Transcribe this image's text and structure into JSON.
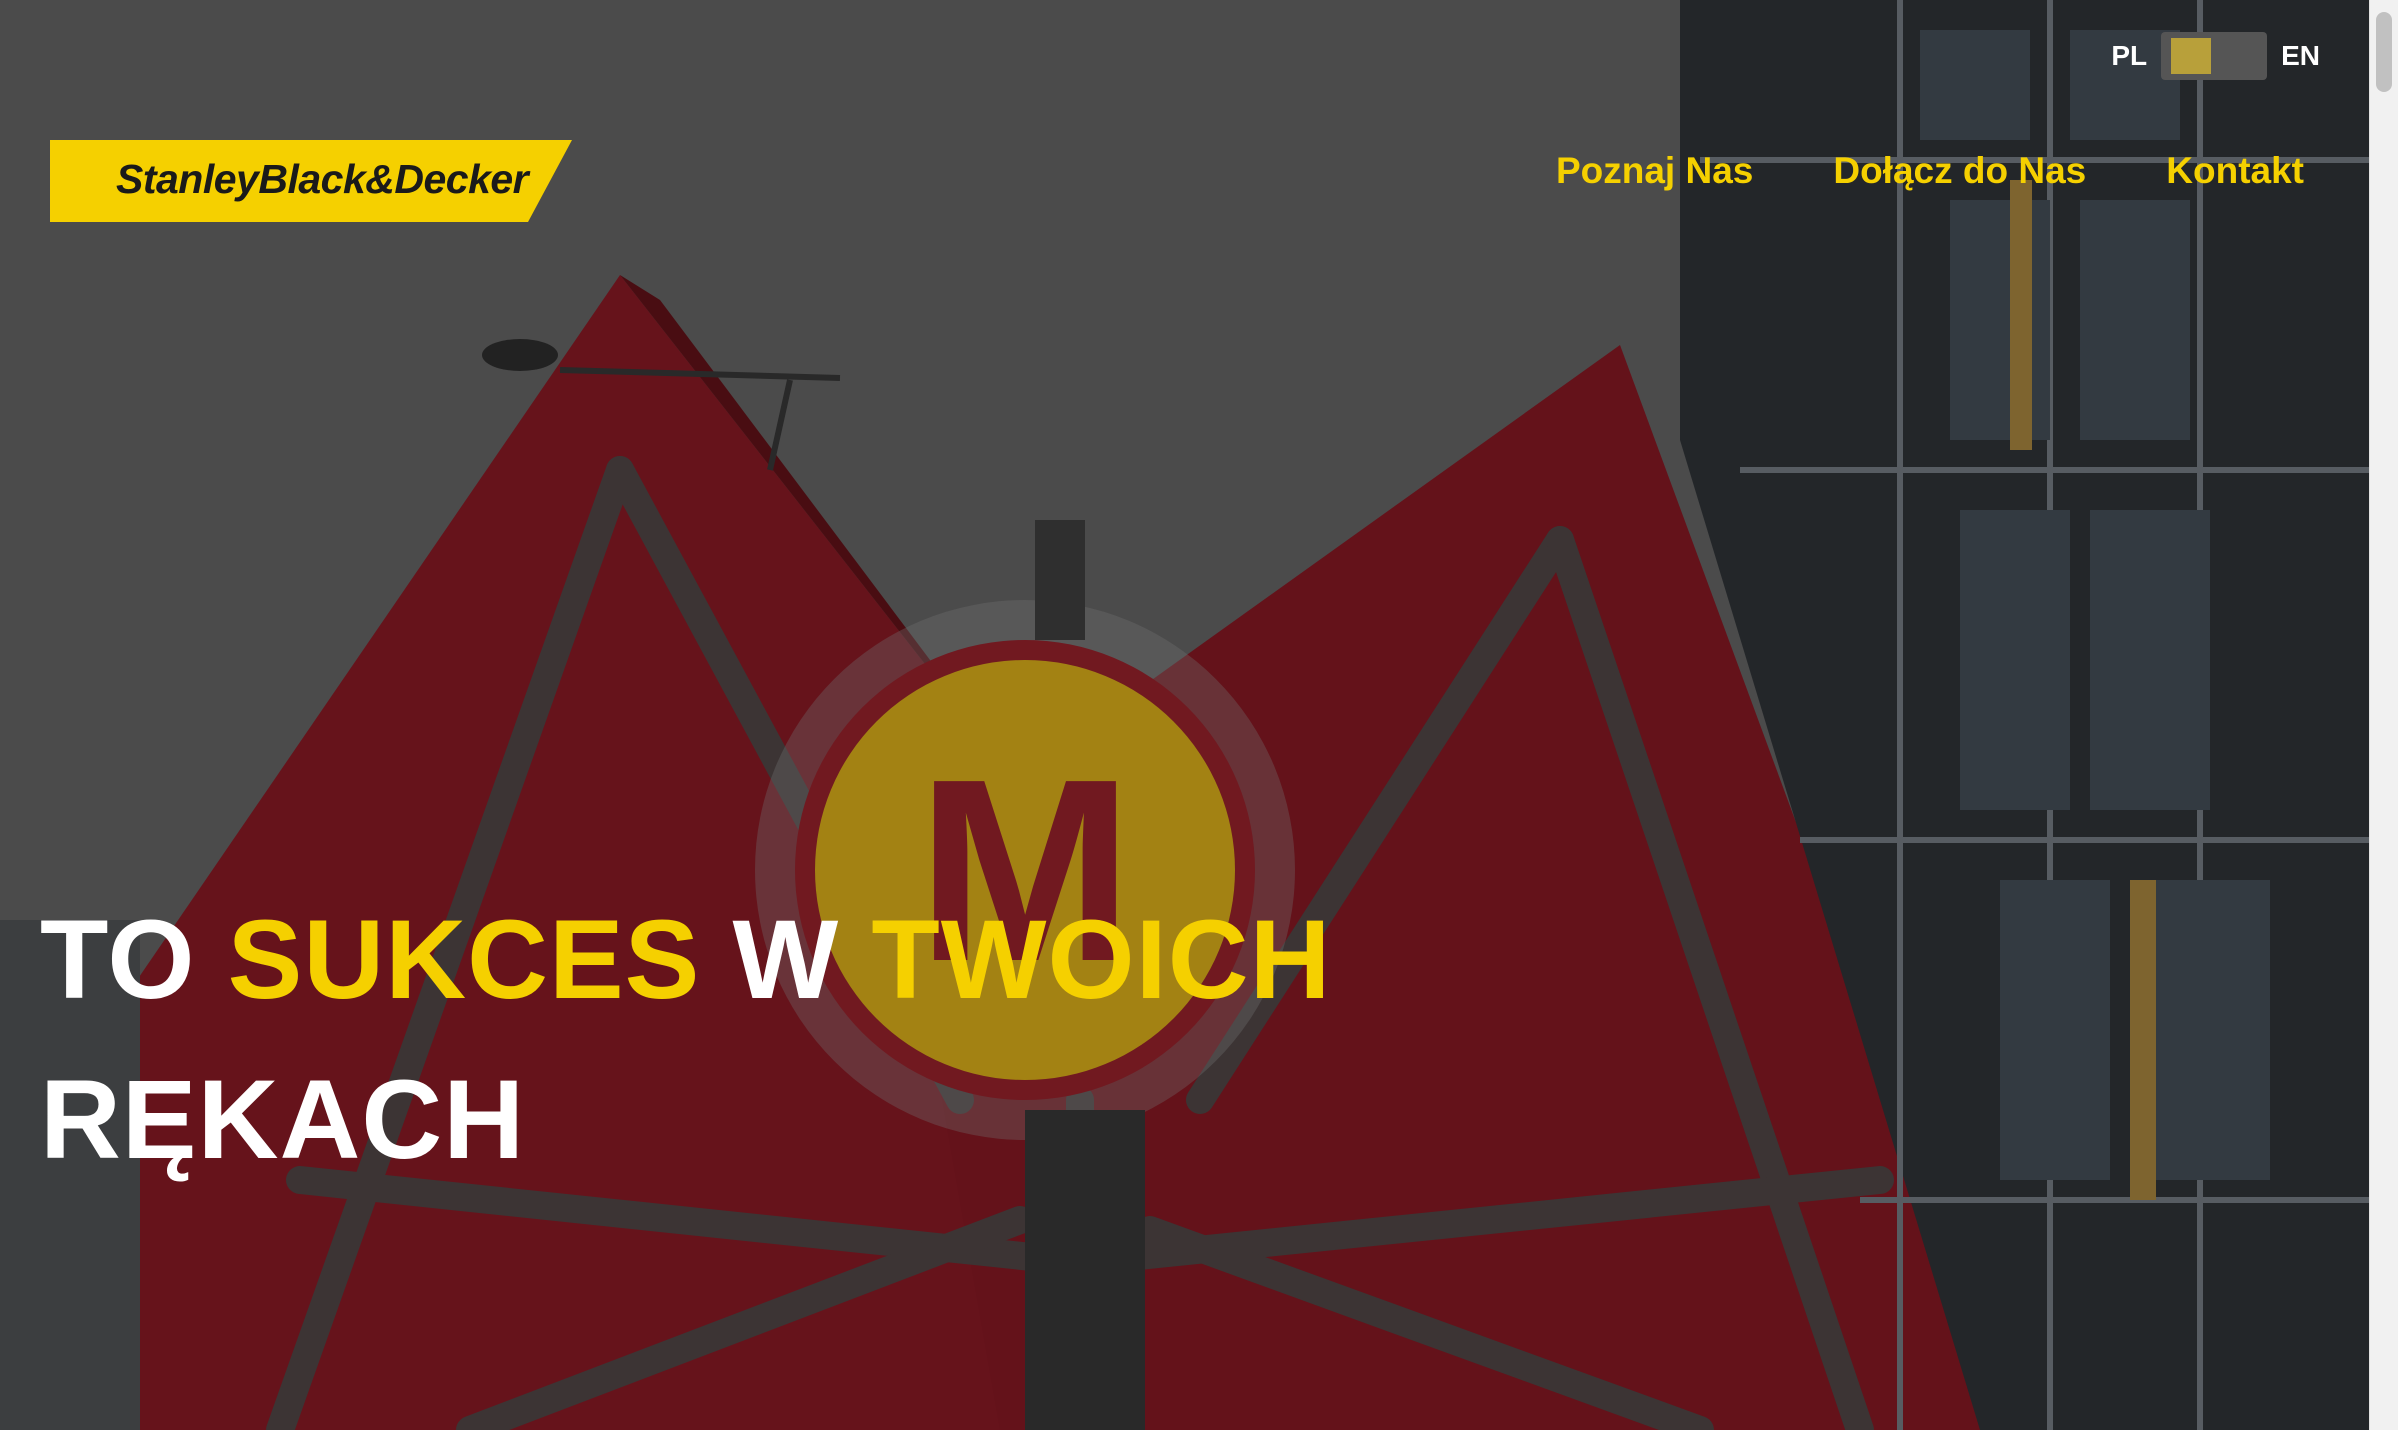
{
  "language_switch": {
    "left": "PL",
    "right": "EN"
  },
  "logo": {
    "text": "StanleyBlack&Decker"
  },
  "nav": {
    "items": [
      "Poznaj Nas",
      "Dołącz do Nas",
      "Kontakt"
    ]
  },
  "headline": {
    "part1": "TO ",
    "part2": "SUKCES",
    "part3": " W ",
    "part4": "TWOICH",
    "part5": "RĘKACH"
  },
  "colors": {
    "accent": "#f5d000",
    "hero_red": "#8a1a24"
  }
}
